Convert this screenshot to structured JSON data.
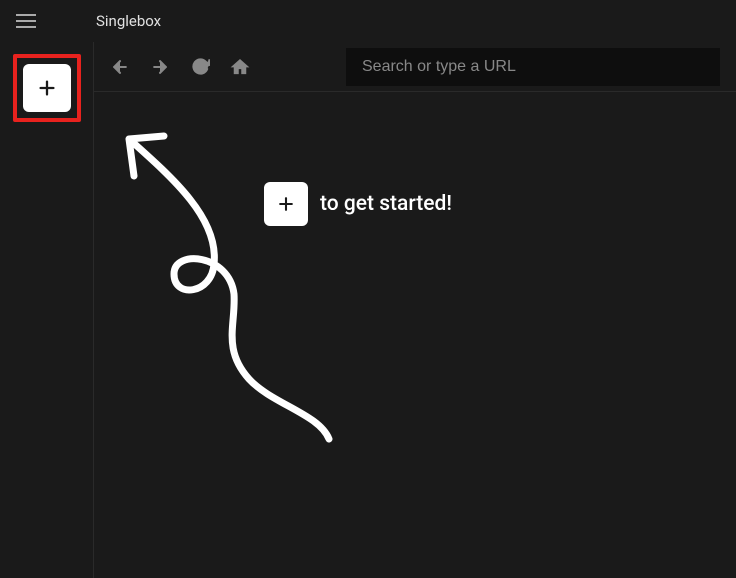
{
  "app": {
    "title": "Singlebox"
  },
  "toolbar": {
    "search_placeholder": "Search or type a URL"
  },
  "onboarding": {
    "get_started_text": "to get started!"
  },
  "colors": {
    "highlight_border": "#e8221e",
    "background": "#1a1a1a"
  }
}
